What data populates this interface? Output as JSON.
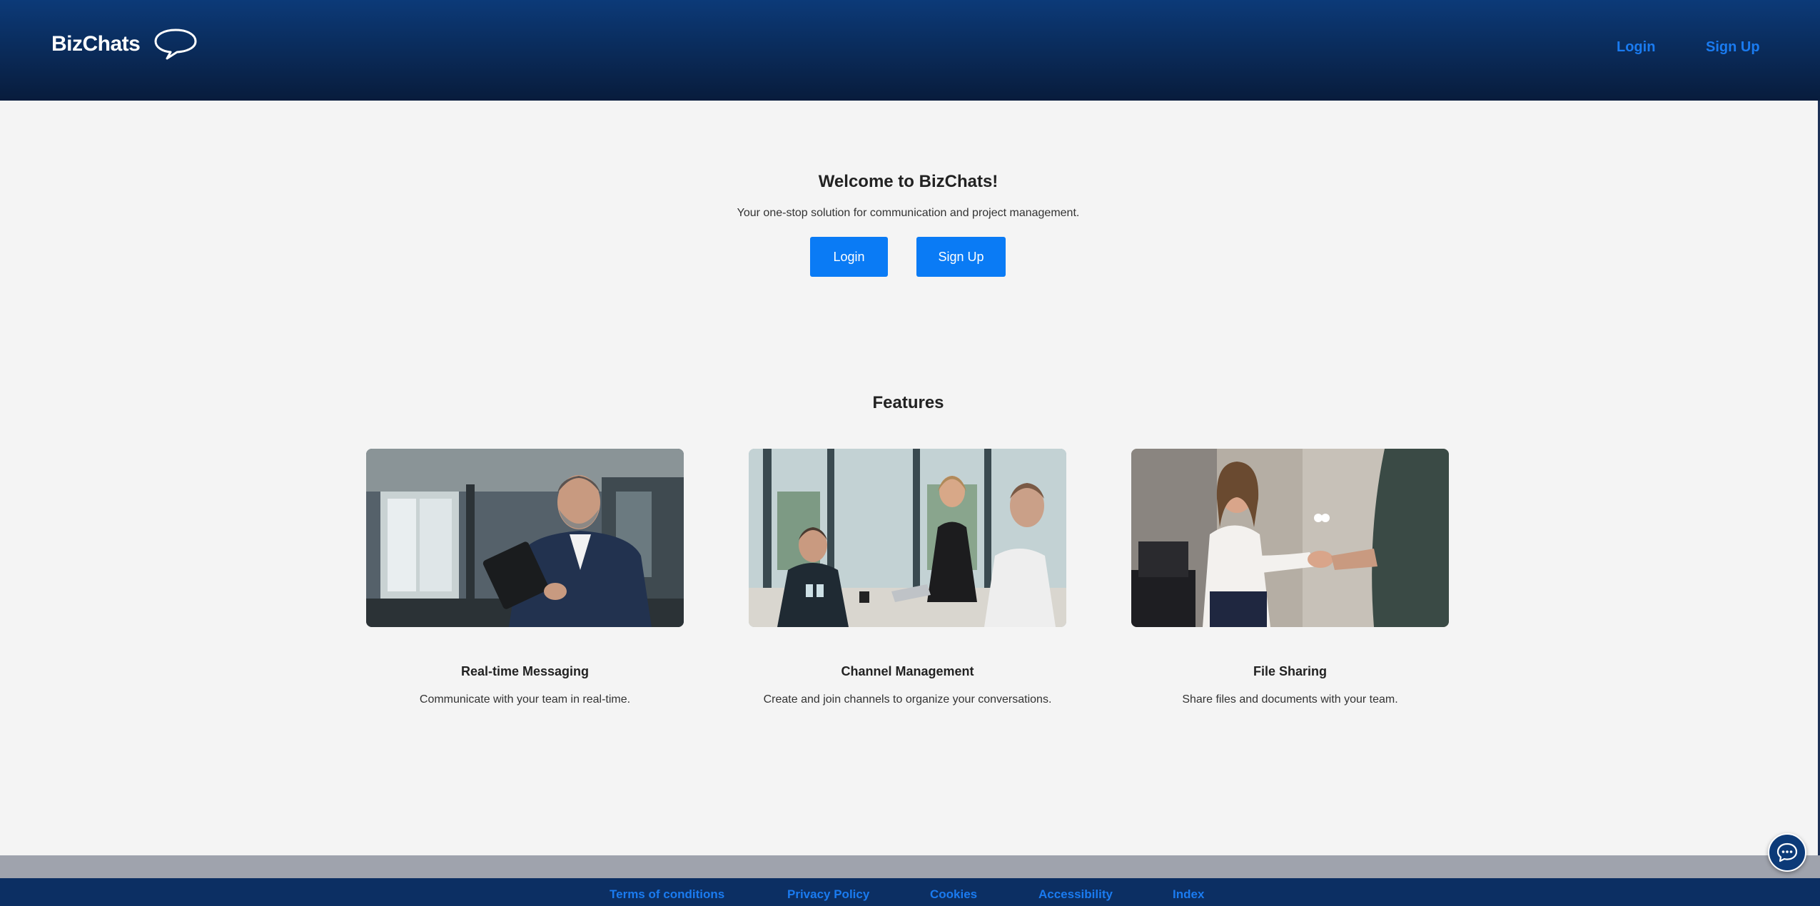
{
  "header": {
    "brand": "BizChats",
    "brand_icon": "speech-bubble-icon",
    "nav": {
      "login_label": "Login",
      "signup_label": "Sign Up"
    }
  },
  "hero": {
    "title": "Welcome to BizChats!",
    "subtitle": "Your one-stop solution for communication and project management.",
    "login_label": "Login",
    "signup_label": "Sign Up"
  },
  "features": {
    "title": "Features",
    "items": [
      {
        "title": "Real-time Messaging",
        "description": "Communicate with your team in real-time.",
        "image": "photo-businessman-with-tablet"
      },
      {
        "title": "Channel Management",
        "description": "Create and join channels to organize your conversations.",
        "image": "photo-team-meeting"
      },
      {
        "title": "File Sharing",
        "description": "Share files and documents with your team.",
        "image": "photo-handshake"
      }
    ]
  },
  "footer": {
    "links": [
      "Terms of conditions",
      "Privacy Policy",
      "Cookies",
      "Accessibility",
      "Index"
    ]
  },
  "chat_widget": {
    "icon": "chat-bubble-icon"
  },
  "colors": {
    "header_top": "#0c3a78",
    "header_bottom": "#081c3c",
    "accent": "#0a7bf5",
    "link": "#1a7bf0",
    "background": "#f4f4f4",
    "footer": "#0c2f63",
    "footer_band": "#9fa3ad"
  }
}
